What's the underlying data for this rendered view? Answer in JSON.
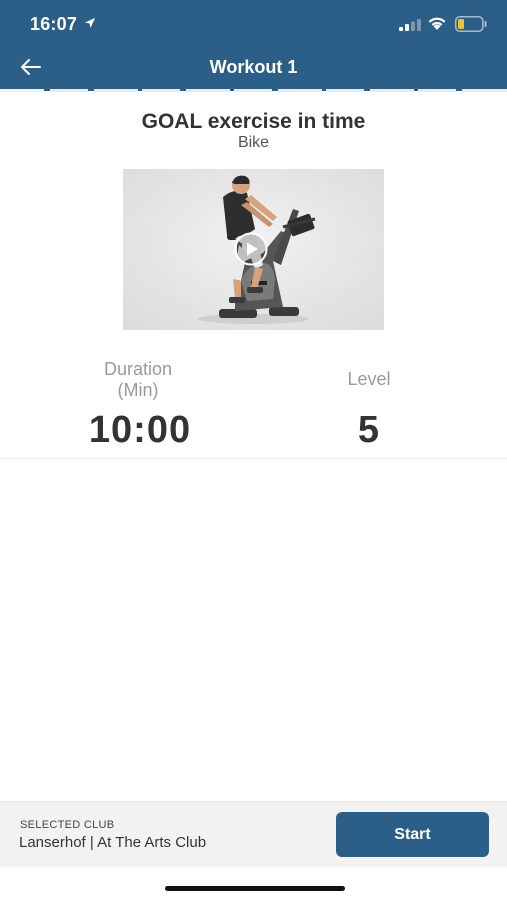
{
  "status_bar": {
    "time": "16:07",
    "icons": [
      "location-arrow-icon",
      "cellular-signal-icon",
      "wifi-icon",
      "battery-low-icon"
    ],
    "battery_color": "#f2c230"
  },
  "nav": {
    "title": "Workout 1",
    "back_icon": "back-arrow-icon"
  },
  "colors": {
    "header": "#2c5f87",
    "button": "#2c5f87",
    "footer": "#f2f2f2"
  },
  "exercise": {
    "title": "GOAL exercise in time",
    "equipment": "Bike",
    "media_icon": "play-icon"
  },
  "stats": [
    {
      "label_line1": "Duration",
      "label_line2": "(Min)",
      "value": "10:00"
    },
    {
      "label_line1": "Level",
      "label_line2": "",
      "value": "5"
    }
  ],
  "footer": {
    "caption": "SELECTED CLUB",
    "club_name": "Lanserhof | At The Arts Club",
    "start_label": "Start"
  }
}
